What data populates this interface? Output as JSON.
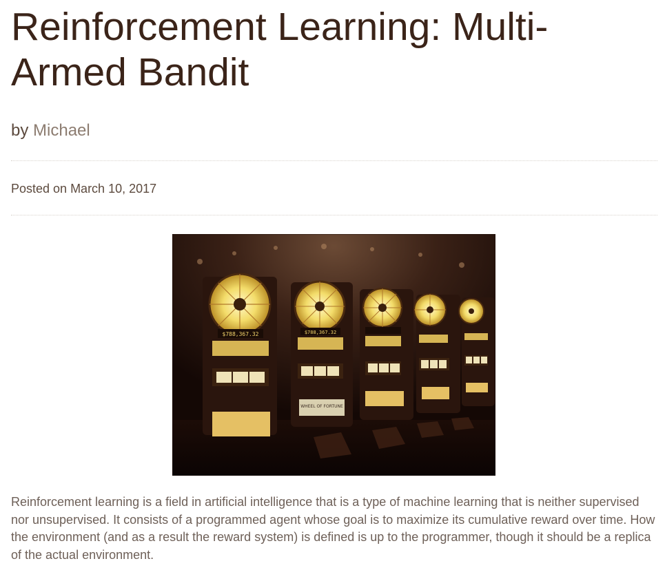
{
  "post": {
    "title": "Reinforcement Learning: Multi-Armed Bandit",
    "by_label": "by",
    "author": "Michael",
    "posted_on": "Posted on March 10, 2017",
    "paragraph": "Reinforcement learning is a field in artificial intelligence that is a type of machine learning that is neither supervised nor unsupervised. It consists of a programmed agent whose goal is to maximize its cumulative reward over time. How the environment (and as a result the reward system) is defined is up to the programmer, though it should be a replica of the actual environment."
  },
  "image": {
    "subject": "slot machines in a casino row",
    "jackpot_readout": "$788,367.32",
    "machine_sign": "WHEEL OF FORTUNE"
  },
  "colors": {
    "title": "#3b2419",
    "text": "#5c4a3e",
    "author_link": "#8c7c70",
    "rule": "#d8d2cc"
  }
}
